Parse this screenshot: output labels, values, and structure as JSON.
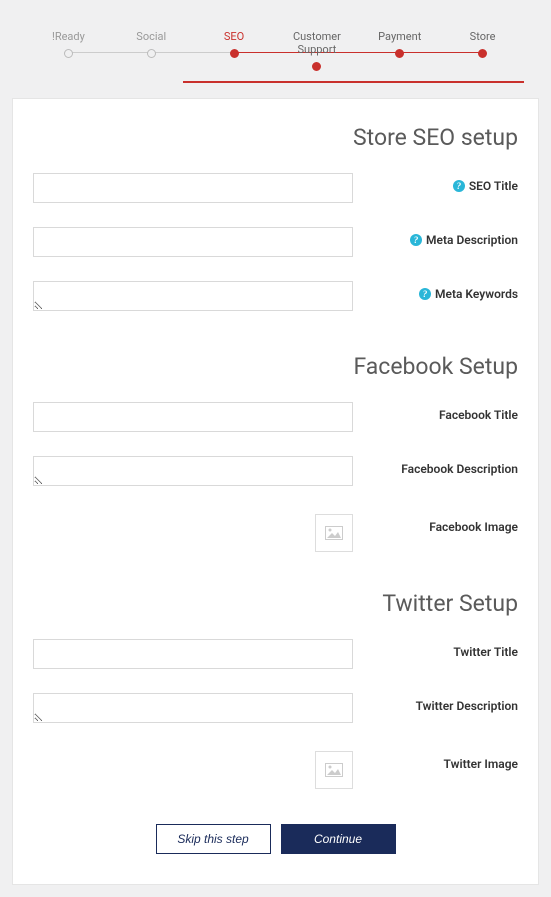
{
  "stepper": {
    "steps": [
      {
        "label": "!Ready",
        "state": "inactive"
      },
      {
        "label": "Social",
        "state": "inactive"
      },
      {
        "label": "SEO",
        "state": "active"
      },
      {
        "label": "Customer Support",
        "state": "completed"
      },
      {
        "label": "Payment",
        "state": "completed"
      },
      {
        "label": "Store",
        "state": "completed"
      }
    ]
  },
  "sections": {
    "seo": {
      "title": "Store SEO setup",
      "fields": {
        "title_label": "SEO Title",
        "meta_desc_label": "Meta Description",
        "meta_keywords_label": "Meta Keywords"
      }
    },
    "facebook": {
      "title": "Facebook Setup",
      "fields": {
        "title_label": "Facebook Title",
        "desc_label": "Facebook Description",
        "image_label": "Facebook Image"
      }
    },
    "twitter": {
      "title": "Twitter Setup",
      "fields": {
        "title_label": "Twitter Title",
        "desc_label": "Twitter Description",
        "image_label": "Twitter Image"
      }
    }
  },
  "buttons": {
    "skip": "Skip this step",
    "continue": "Continue"
  },
  "values": {
    "seo_title": "",
    "seo_meta_desc": "",
    "seo_meta_keywords": "",
    "fb_title": "",
    "fb_desc": "",
    "tw_title": "",
    "tw_desc": ""
  }
}
